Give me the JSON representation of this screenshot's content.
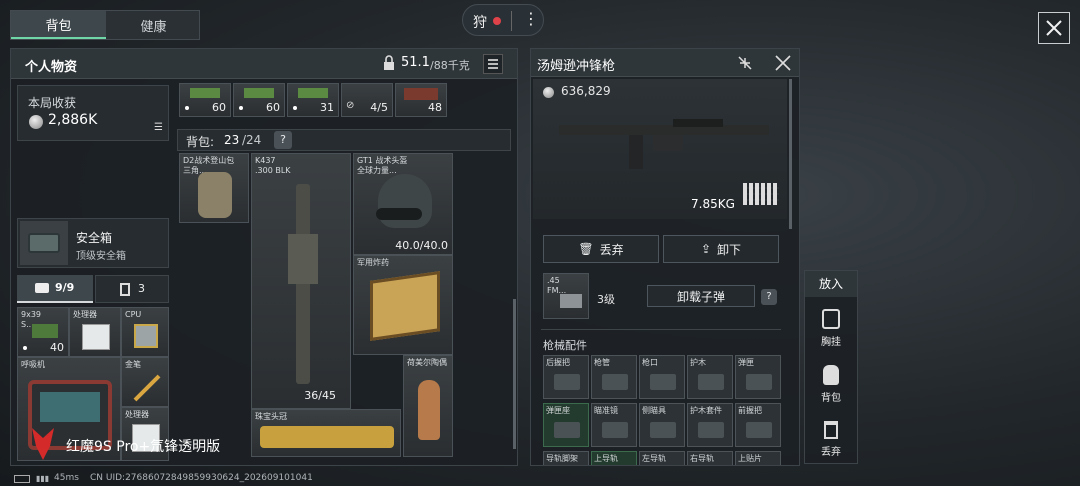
{
  "tabs": [
    {
      "label": "背包",
      "active": true
    },
    {
      "label": "健康",
      "active": false
    }
  ],
  "top_center": {
    "label": "狩"
  },
  "personal": {
    "title": "个人物资",
    "weight_value": "51.1",
    "weight_limit": "/88千克",
    "earnings_label": "本局收获",
    "earnings_value": "2,886K"
  },
  "ammo_row": [
    {
      "count": "60"
    },
    {
      "count": "60"
    },
    {
      "count": "31"
    },
    {
      "count": "4/5"
    },
    {
      "count": "48"
    }
  ],
  "backpack": {
    "label": "背包:",
    "count": "23",
    "capacity": "/24",
    "help": "?"
  },
  "items": {
    "bag": "D2战术登山包\n三角...",
    "rifle_name": "K437",
    "rifle_cal": ".300 BLK",
    "rifle_ammo": "36/45",
    "helmet_name": "GT1 战术头盔",
    "helmet_sub": "全球力量...",
    "helmet_dura": "40.0/40.0",
    "explosive": "军用炸药",
    "figurine": "荷美尔陶偶",
    "crown": "珠宝头冠"
  },
  "safe_box": {
    "title": "安全箱",
    "sub": "顶级安全箱"
  },
  "pockets": {
    "tab1": "9/9",
    "tab2": "3"
  },
  "pocket_items": {
    "ammo": "9x39\nS...",
    "ammo_count": "40",
    "processor1": "处理器",
    "cpu": "CPU",
    "respirator": "呼吸机",
    "pen": "金笔",
    "processor2": "处理器"
  },
  "watermark": "红魔9S Pro+氘锋透明版",
  "status": {
    "ping": "45ms",
    "uid": "CN UID:2768607284985993062​4_202609101041"
  },
  "weapon": {
    "title": "汤姆逊冲锋枪",
    "price": "636,829",
    "weight": "7.85KG",
    "discard": "丢弃",
    "unload": "卸下",
    "ammo_short": ".45\nFM...",
    "ammo_level": "3级",
    "unload_ammo": "卸载子弹",
    "help": "?",
    "attachments_title": "枪械配件",
    "attachments": [
      {
        "label": "后握把",
        "green": false
      },
      {
        "label": "枪管",
        "green": false
      },
      {
        "label": "枪口",
        "green": false
      },
      {
        "label": "护木",
        "green": false
      },
      {
        "label": "弹匣",
        "green": false
      },
      {
        "label": "弹匣座",
        "green": true
      },
      {
        "label": "瞄准镜",
        "green": false
      },
      {
        "label": "侧瞄具",
        "green": false
      },
      {
        "label": "护木套件",
        "green": false
      },
      {
        "label": "前握把",
        "green": false
      },
      {
        "label": "导轨脚架",
        "green": false
      },
      {
        "label": "上导轨",
        "green": true
      },
      {
        "label": "左导轨",
        "green": false
      },
      {
        "label": "右导轨",
        "green": false
      },
      {
        "label": "上贴片",
        "green": false
      }
    ]
  },
  "side_panel": {
    "title": "放入",
    "items": [
      {
        "label": "胸挂"
      },
      {
        "label": "背包"
      },
      {
        "label": "丢弃"
      }
    ]
  },
  "colors": {
    "accent_green": "#3c6a4c",
    "record_red": "#e0424a",
    "panel": "#1c2125"
  }
}
